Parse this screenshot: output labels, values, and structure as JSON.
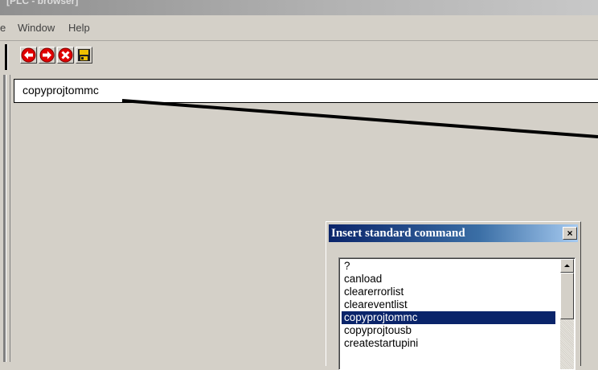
{
  "window": {
    "title": "[PLC - browser]"
  },
  "menu": [
    {
      "label": "e"
    },
    {
      "label": "Window"
    },
    {
      "label": "Help"
    }
  ],
  "toolbar": {
    "buttons": [
      {
        "icon": "back-arrow-icon",
        "color": "#e00000"
      },
      {
        "icon": "forward-arrow-icon",
        "color": "#e00000"
      },
      {
        "icon": "stop-icon",
        "color": "#e00000"
      },
      {
        "icon": "save-icon",
        "color": "#f0c000"
      }
    ]
  },
  "command": {
    "value": "copyprojtommc"
  },
  "dialog": {
    "title": "Insert standard command",
    "close_label": "×",
    "items": [
      {
        "label": "?"
      },
      {
        "label": "canload"
      },
      {
        "label": "clearerrorlist"
      },
      {
        "label": "cleareventlist"
      },
      {
        "label": "copyprojtommc",
        "selected": true
      },
      {
        "label": "copyprojtousb"
      },
      {
        "label": "createstartupini"
      }
    ]
  },
  "colors": {
    "selection": "#0a246a",
    "face": "#d4d0c8"
  }
}
